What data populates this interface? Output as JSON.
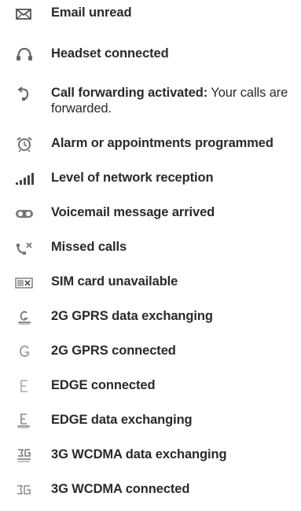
{
  "items": [
    {
      "icon": "envelope-icon",
      "label": "Email unread"
    },
    {
      "icon": "headset-icon",
      "label": "Headset connected"
    },
    {
      "icon": "call-forward-icon",
      "label": "Call forwarding activated:",
      "description": "Your calls are forwarded."
    },
    {
      "icon": "alarm-clock-icon",
      "label": "Alarm or appointments programmed"
    },
    {
      "icon": "signal-bars-icon",
      "label": "Level of network reception"
    },
    {
      "icon": "voicemail-icon",
      "label": "Voicemail message arrived"
    },
    {
      "icon": "missed-call-icon",
      "label": "Missed calls"
    },
    {
      "icon": "sim-unavailable-icon",
      "label": "SIM card unavailable"
    },
    {
      "icon": "gprs-data-icon",
      "label": "2G GPRS data exchanging"
    },
    {
      "icon": "gprs-connected-icon",
      "label": "2G GPRS connected"
    },
    {
      "icon": "edge-connected-icon",
      "label": "EDGE connected"
    },
    {
      "icon": "edge-data-icon",
      "label": "EDGE data exchanging"
    },
    {
      "icon": "wcdma-data-icon",
      "label": "3G WCDMA data exchanging"
    },
    {
      "icon": "wcdma-connected-icon",
      "label": "3G WCDMA connected"
    }
  ]
}
